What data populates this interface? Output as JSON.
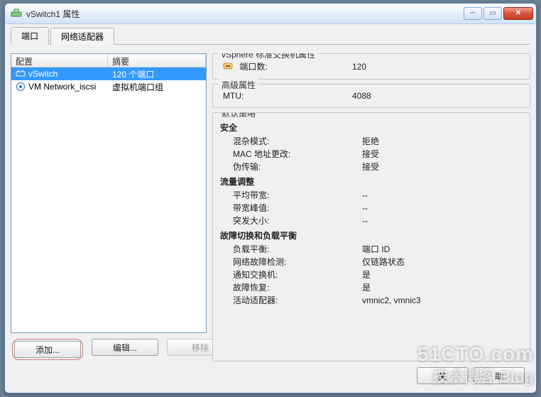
{
  "window": {
    "title": "vSwitch1 属性"
  },
  "tabs": {
    "port": "端口",
    "adapter": "网络适配器"
  },
  "list": {
    "headers": {
      "config": "配置",
      "summary": "摘要"
    },
    "rows": [
      {
        "name": "vSwitch",
        "summary": "120 个端口",
        "icon": "vswitch"
      },
      {
        "name": "VM Network_iscsi",
        "summary": "虚拟机端口组",
        "icon": "portgroup"
      }
    ]
  },
  "left_buttons": {
    "add": "添加...",
    "edit": "编辑...",
    "remove": "移除"
  },
  "right": {
    "vs_props_title": "vSphere 标准交换机属性",
    "port_count_label": "端口数:",
    "port_count_value": "120",
    "adv_title": "高级属性",
    "mtu_label": "MTU:",
    "mtu_value": "4088",
    "policy_title": "默认策略",
    "sec_title": "安全",
    "promisc_label": "混杂模式:",
    "promisc_value": "拒绝",
    "mac_label": "MAC 地址更改:",
    "mac_value": "接受",
    "forged_label": "伪传输:",
    "forged_value": "接受",
    "shape_title": "流量调整",
    "avg_label": "平均带宽:",
    "avg_value": "--",
    "peak_label": "带宽峰值:",
    "peak_value": "--",
    "burst_label": "突发大小:",
    "burst_value": "--",
    "fail_title": "故障切换和负载平衡",
    "lb_label": "负载平衡:",
    "lb_value": "端口 ID",
    "detect_label": "网络故障检测:",
    "detect_value": "仅链路状态",
    "notify_label": "通知交换机:",
    "notify_value": "是",
    "failback_label": "故障恢复:",
    "failback_value": "是",
    "active_label": "活动适配器:",
    "active_value": "vmnic2, vmnic3"
  },
  "footer": {
    "close_left": "关",
    "help_right": "助"
  },
  "watermark": {
    "logo": "51CTO.com",
    "sub": "技术博客 Blog"
  }
}
